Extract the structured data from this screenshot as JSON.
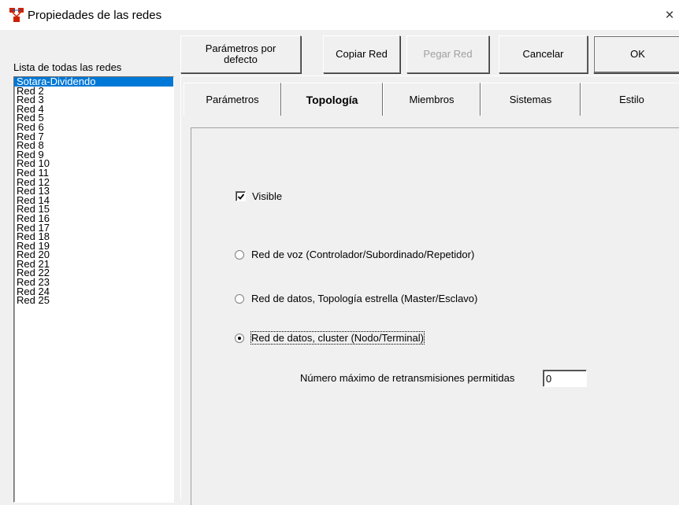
{
  "window": {
    "title": "Propiedades de las redes",
    "close_glyph": "×",
    "app_icon": "network-app-icon"
  },
  "list": {
    "label": "Lista de todas las redes",
    "items": [
      "Sotara-Dividendo",
      "Red  2",
      "Red  3",
      "Red  4",
      "Red  5",
      "Red  6",
      "Red  7",
      "Red  8",
      "Red  9",
      "Red 10",
      "Red 11",
      "Red 12",
      "Red 13",
      "Red 14",
      "Red 15",
      "Red 16",
      "Red 17",
      "Red 18",
      "Red 19",
      "Red 20",
      "Red 21",
      "Red 22",
      "Red 23",
      "Red 24",
      "Red 25"
    ],
    "selected_index": 0
  },
  "toolbar": {
    "defaults_label_line1": "Parámetros por",
    "defaults_label_line2": "defecto",
    "copy_label": "Copiar Red",
    "paste_label": "Pegar Red",
    "cancel_label": "Cancelar",
    "ok_label": "OK"
  },
  "tabs": [
    {
      "label": "Parámetros"
    },
    {
      "label": "Topología",
      "active": true
    },
    {
      "label": "Miembros"
    },
    {
      "label": "Sistemas"
    },
    {
      "label": "Estilo"
    }
  ],
  "topology": {
    "visible_label": "Visible",
    "visible_checked": true,
    "radio_voice": "Red de voz (Controlador/Subordinado/Repetidor)",
    "radio_star": "Red de datos, Topología estrella (Master/Esclavo)",
    "radio_cluster": "Red de datos, cluster (Nodo/Terminal)",
    "selected_radio": "cluster",
    "retrans_label": "Número máximo de retransmisiones permitidas",
    "retrans_value": "0"
  },
  "colors": {
    "selection": "#0078d7",
    "window_bg": "#f0f0f0"
  }
}
